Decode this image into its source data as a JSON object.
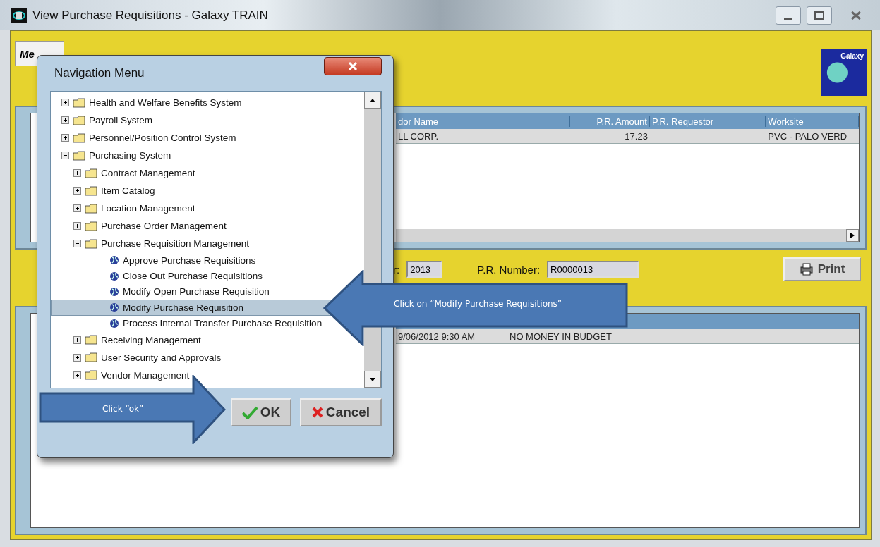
{
  "window": {
    "title": "View Purchase Requisitions - Galaxy TRAIN"
  },
  "header": {
    "menu_button": "Me",
    "logo_text": "Galaxy"
  },
  "requisitions_grid": {
    "columns": [
      "dor Name",
      "P.R. Amount",
      "P.R. Requestor",
      "Worksite"
    ],
    "rows": [
      {
        "cells": [
          "LL CORP.",
          "17.23",
          "",
          "PVC - PALO VERD"
        ],
        "selected": true
      }
    ]
  },
  "fields": [
    {
      "label": "r:",
      "value": "2013"
    },
    {
      "label": "P.R. Number:",
      "value": "R0000013"
    }
  ],
  "print_button": "Print",
  "approvals_grid": {
    "rows": [
      {
        "cells": [
          "9/06/2012 9:30 AM",
          "NO MONEY IN BUDGET"
        ]
      }
    ]
  },
  "dialog": {
    "title": "Navigation Menu",
    "tree": [
      {
        "label": "Health and Welfare Benefits System",
        "kind": "folder",
        "expanded": false,
        "selected": false
      },
      {
        "label": "Payroll System",
        "kind": "folder",
        "expanded": false,
        "selected": false
      },
      {
        "label": "Personnel/Position Control System",
        "kind": "folder",
        "expanded": false,
        "selected": false
      },
      {
        "label": "Purchasing System",
        "kind": "folder",
        "expanded": true,
        "selected": false,
        "children": [
          {
            "label": "Contract Management",
            "kind": "folder",
            "expanded": false,
            "selected": false
          },
          {
            "label": "Item Catalog",
            "kind": "folder",
            "expanded": false,
            "selected": false
          },
          {
            "label": "Location Management",
            "kind": "folder",
            "expanded": false,
            "selected": false
          },
          {
            "label": "Purchase Order Management",
            "kind": "folder",
            "expanded": false,
            "selected": false
          },
          {
            "label": "Purchase Requisition Management",
            "kind": "folder",
            "expanded": true,
            "selected": false,
            "children": [
              {
                "label": "Approve Purchase Requisitions",
                "kind": "action",
                "selected": false
              },
              {
                "label": "Close Out Purchase Requisitions",
                "kind": "action",
                "selected": false
              },
              {
                "label": "Modify Open Purchase Requisition",
                "kind": "action",
                "selected": false
              },
              {
                "label": "Modify Purchase Requisition",
                "kind": "action",
                "selected": true
              },
              {
                "label": "Process Internal Transfer Purchase Requisition",
                "kind": "action",
                "selected": false
              }
            ]
          },
          {
            "label": "Receiving Management",
            "kind": "folder",
            "expanded": false,
            "selected": false
          },
          {
            "label": "User Security and Approvals",
            "kind": "folder",
            "expanded": false,
            "selected": false
          },
          {
            "label": "Vendor Management",
            "kind": "folder",
            "expanded": false,
            "selected": false
          }
        ]
      }
    ],
    "buttons": [
      {
        "label": "OK",
        "kind": "ok"
      },
      {
        "label": "Cancel",
        "kind": "cancel"
      }
    ]
  },
  "callouts": [
    {
      "text": "Click on “Modify Purchase Requisitions”",
      "kind": "left"
    },
    {
      "text": "Click “ok”",
      "kind": "right"
    }
  ]
}
